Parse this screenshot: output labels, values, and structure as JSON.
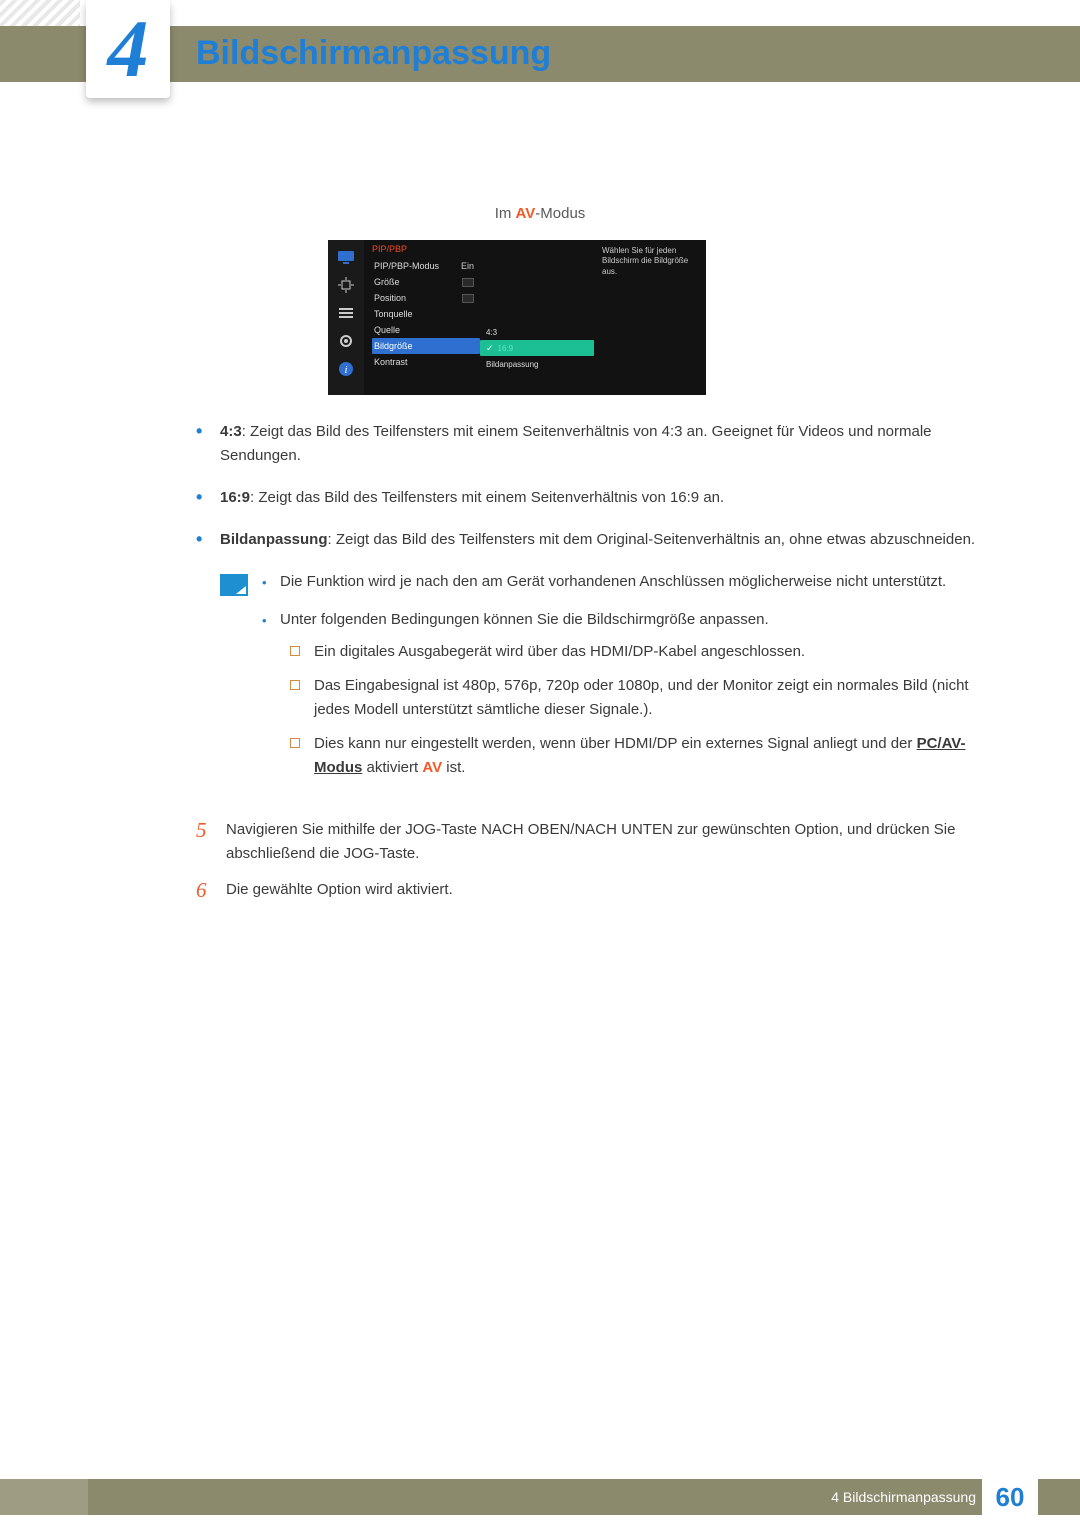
{
  "chapter": {
    "number": "4",
    "title": "Bildschirmanpassung"
  },
  "caption": {
    "prefix": "Im ",
    "av": "AV",
    "suffix": "-Modus"
  },
  "osd": {
    "heading": "PIP/PBP",
    "rows": [
      {
        "label": "PIP/PBP-Modus",
        "value": "Ein"
      },
      {
        "label": "Größe"
      },
      {
        "label": "Position"
      },
      {
        "label": "Tonquelle"
      },
      {
        "label": "Quelle"
      },
      {
        "label": "Bildgröße",
        "selected": true
      },
      {
        "label": "Kontrast"
      }
    ],
    "options": [
      {
        "label": "4:3"
      },
      {
        "label": "16:9",
        "active": true
      },
      {
        "label": "Bildanpassung"
      }
    ],
    "hint": "Wählen Sie für jeden Bildschirm die Bildgröße aus."
  },
  "bullets": {
    "b1_label": "4:3",
    "b1_text": ": Zeigt das Bild des Teilfensters mit einem Seitenverhältnis von 4:3 an. Geeignet für Videos und normale Sendungen.",
    "b2_label": "16:9",
    "b2_text": ": Zeigt das Bild des Teilfensters mit einem Seitenverhältnis von 16:9 an.",
    "b3_label": "Bildanpassung",
    "b3_text": ": Zeigt das Bild des Teilfensters mit dem Original-Seitenverhältnis an, ohne etwas abzuschneiden."
  },
  "note": {
    "n1": "Die Funktion wird je nach den am Gerät vorhandenen Anschlüssen möglicherweise nicht unterstützt.",
    "n2": "Unter folgenden Bedingungen können Sie die Bildschirmgröße anpassen.",
    "s1": "Ein digitales Ausgabegerät wird über das HDMI/DP-Kabel angeschlossen.",
    "s2": "Das Eingabesignal ist 480p, 576p, 720p oder 1080p, und der Monitor zeigt ein normales Bild (nicht jedes Modell unterstützt sämtliche dieser Signale.).",
    "s3a": "Dies kann nur eingestellt werden, wenn über HDMI/DP ein externes Signal anliegt und der ",
    "s3link": "PC/AV-Modus",
    "s3b": " aktiviert ",
    "s3av": "AV",
    "s3c": " ist."
  },
  "steps": {
    "num5": "5",
    "t5": "Navigieren Sie mithilfe der JOG-Taste NACH OBEN/NACH UNTEN zur gewünschten Option, und drücken Sie abschließend die JOG-Taste.",
    "num6": "6",
    "t6": "Die gewählte Option wird aktiviert."
  },
  "footer": {
    "label": "4 Bildschirmanpassung",
    "page": "60"
  }
}
